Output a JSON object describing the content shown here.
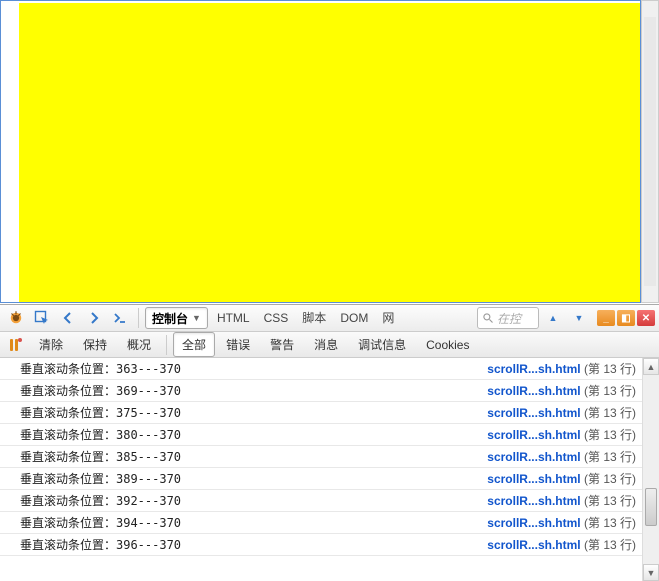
{
  "toolbar1": {
    "panel_label": "控制台",
    "tabs": [
      "HTML",
      "CSS",
      "脚本",
      "DOM",
      "网"
    ],
    "search_placeholder": "在控"
  },
  "toolbar2": {
    "clear": "清除",
    "persist": "保持",
    "profile": "概况",
    "all": "全部",
    "errors": "错误",
    "warnings": "警告",
    "info": "消息",
    "debug": "调试信息",
    "cookies": "Cookies"
  },
  "log_prefix": "垂直滚动条位置：",
  "log_source_file": "scrollR...sh.html",
  "log_source_line_prefix": "(第 ",
  "log_source_line_suffix": " 行)",
  "log_line_no": "13",
  "logs": [
    {
      "a": "",
      "b": "",
      "cut": true
    },
    {
      "a": "363",
      "b": "370"
    },
    {
      "a": "369",
      "b": "370"
    },
    {
      "a": "375",
      "b": "370"
    },
    {
      "a": "380",
      "b": "370"
    },
    {
      "a": "385",
      "b": "370"
    },
    {
      "a": "389",
      "b": "370"
    },
    {
      "a": "392",
      "b": "370"
    },
    {
      "a": "394",
      "b": "370"
    },
    {
      "a": "396",
      "b": "370"
    }
  ]
}
